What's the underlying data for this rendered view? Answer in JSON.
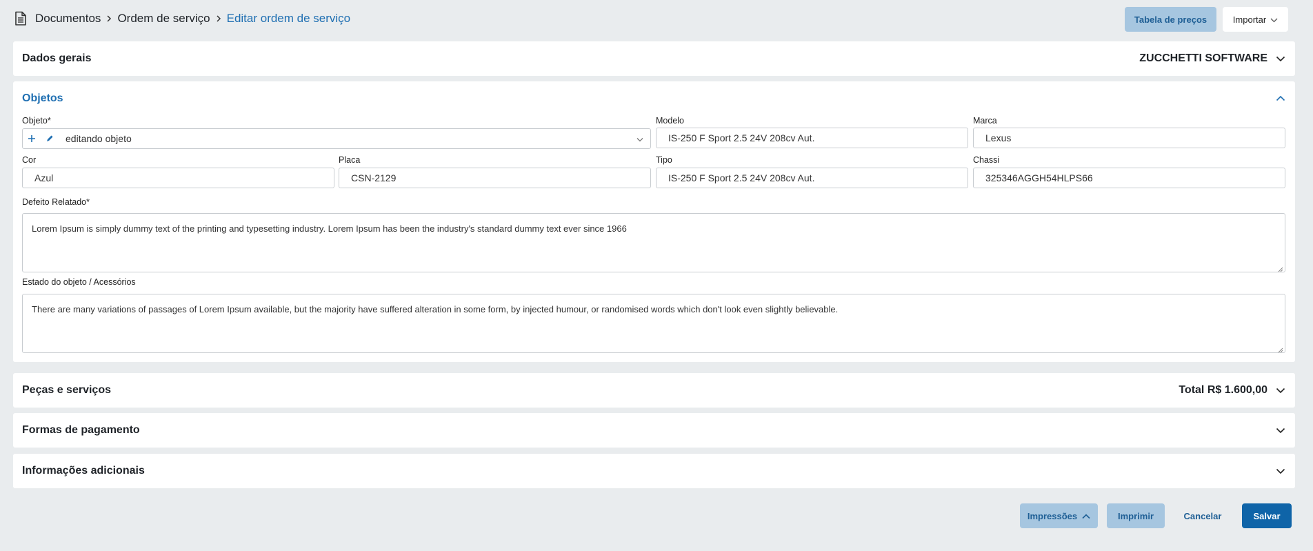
{
  "breadcrumb": {
    "items": [
      "Documentos",
      "Ordem de serviço"
    ],
    "current": "Editar ordem de serviço"
  },
  "toolbar": {
    "price_table_label": "Tabela de preços",
    "import_label": "Importar"
  },
  "sections": {
    "general": {
      "title": "Dados gerais",
      "right": "ZUCCHETTI SOFTWARE"
    },
    "objects": {
      "title": "Objetos"
    },
    "parts": {
      "title": "Peças e serviços",
      "right": "Total R$ 1.600,00"
    },
    "payment": {
      "title": "Formas de pagamento"
    },
    "additional": {
      "title": "Informações adicionais"
    }
  },
  "form": {
    "objeto": {
      "label": "Objeto*",
      "value": "editando objeto"
    },
    "modelo": {
      "label": "Modelo",
      "value": "IS-250 F Sport 2.5 24V 208cv Aut."
    },
    "marca": {
      "label": "Marca",
      "value": "Lexus"
    },
    "cor": {
      "label": "Cor",
      "value": "Azul"
    },
    "placa": {
      "label": "Placa",
      "value": "CSN-2129"
    },
    "tipo": {
      "label": "Tipo",
      "value": "IS-250 F Sport 2.5 24V 208cv Aut."
    },
    "chassi": {
      "label": "Chassi",
      "value": "325346AGGH54HLPS66"
    },
    "defeito": {
      "label": "Defeito Relatado*",
      "value": "Lorem Ipsum is simply dummy text of the printing and typesetting industry. Lorem Ipsum has been the industry's standard dummy text ever since 1966"
    },
    "estado": {
      "label": "Estado do objeto / Acessórios",
      "value": "There are many variations of passages of Lorem Ipsum available, but the majority have suffered alteration in some form, by injected humour, or randomised words which don't look even slightly believable."
    }
  },
  "footer": {
    "prints_label": "Impressões",
    "print_label": "Imprimir",
    "cancel_label": "Cancelar",
    "save_label": "Salvar"
  },
  "colors": {
    "accent": "#1f6fb2",
    "primary_button": "#0f64a8",
    "light_button": "#a6c6e0",
    "background": "#e9ecee"
  },
  "icons": {
    "breadcrumb": "document-icon",
    "separator": "chevron-right-icon",
    "expand": "chevron-down-icon",
    "collapse": "chevron-up-icon",
    "add": "plus-icon",
    "edit": "pencil-icon"
  }
}
